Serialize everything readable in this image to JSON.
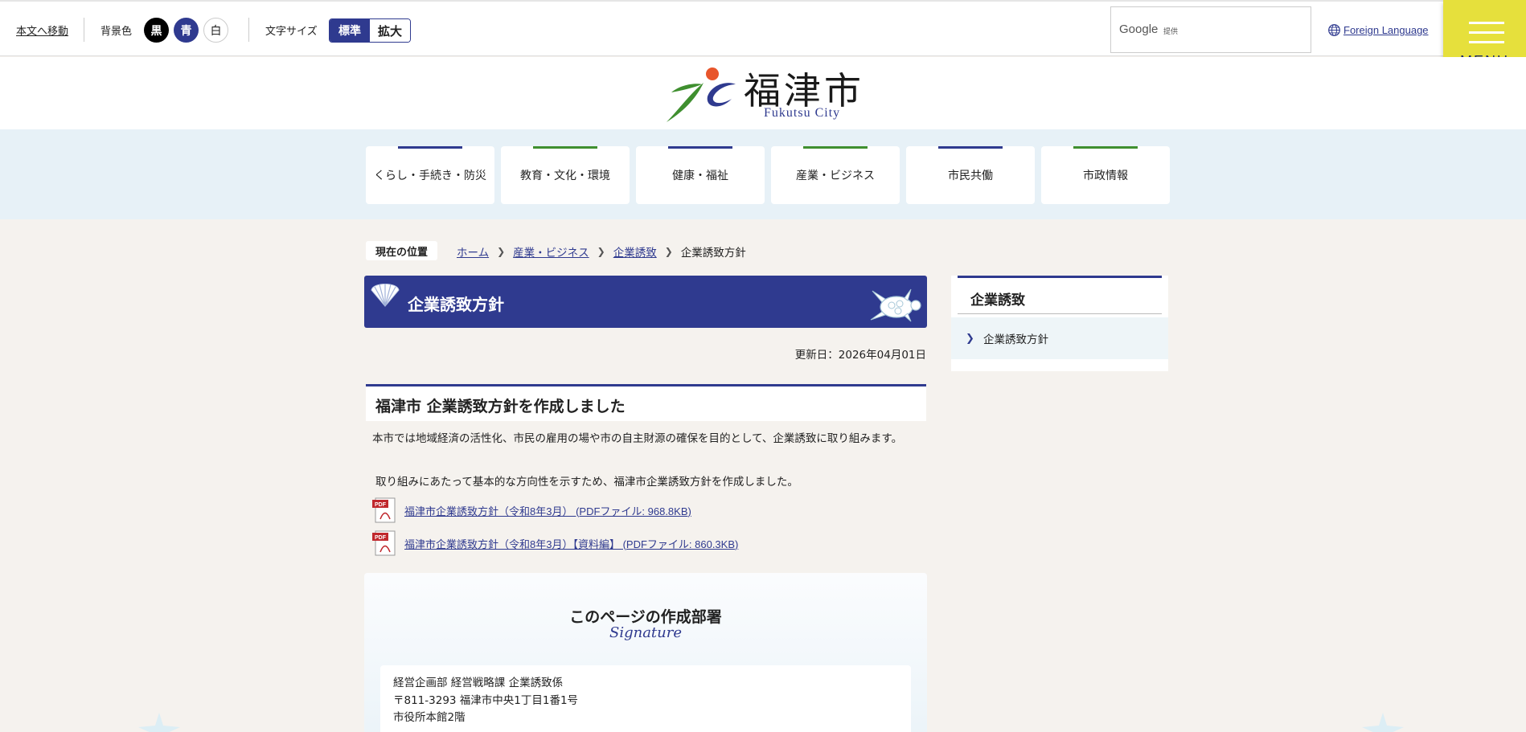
{
  "topbar": {
    "skip_link": "本文へ移動",
    "bg_label": "背景色",
    "bg_options": [
      "黒",
      "青",
      "白"
    ],
    "font_size_label": "文字サイズ",
    "font_size_options": [
      "標準",
      "拡大"
    ],
    "search_brand": "Google",
    "search_sub": "提供",
    "foreign_language": "Foreign Language",
    "menu_label": "MENU"
  },
  "header": {
    "logo_jp": "福津市",
    "logo_en": "Fukutsu City"
  },
  "gnav": [
    {
      "label": "くらし・手続き・防災",
      "accent": "#2f3a8f"
    },
    {
      "label": "教育・文化・環境",
      "accent": "#3f8f2f"
    },
    {
      "label": "健康・福祉",
      "accent": "#2f3a8f"
    },
    {
      "label": "産業・ビジネス",
      "accent": "#3f8f2f"
    },
    {
      "label": "市民共働",
      "accent": "#2f3a8f"
    },
    {
      "label": "市政情報",
      "accent": "#3f8f2f"
    }
  ],
  "breadcrumb": {
    "label": "現在の位置",
    "items": [
      "ホーム",
      "産業・ビジネス",
      "企業誘致"
    ],
    "current": "企業誘致方針"
  },
  "page": {
    "title": "企業誘致方針",
    "updated": "更新日：2026年04月01日",
    "heading": "福津市 企業誘致方針を作成しました",
    "para1": "本市では地域経済の活性化、市民の雇用の場や市の自主財源の確保を目的として、企業誘致に取り組みます。",
    "para2": "取り組みにあたって基本的な方向性を示すため、福津市企業誘致方針を作成しました。",
    "pdfs": [
      "福津市企業誘致方針（令和8年3月） (PDFファイル: 968.8KB)",
      "福津市企業誘致方針（令和8年3月）【資料編】 (PDFファイル: 860.3KB)"
    ]
  },
  "signature": {
    "title": "このページの作成部署",
    "subtitle": "Signature",
    "lines": [
      "経営企画部 経営戦略課 企業誘致係",
      "〒811-3293 福津市中央1丁目1番1号",
      "市役所本館2階"
    ]
  },
  "sidenav": {
    "title": "企業誘致",
    "items": [
      "企業誘致方針"
    ]
  },
  "colors": {
    "brand_blue": "#2f3a8f",
    "menu_yellow": "#e6e03c",
    "nav_bg": "#e7f1f7",
    "page_bg": "#f5f2ee"
  }
}
